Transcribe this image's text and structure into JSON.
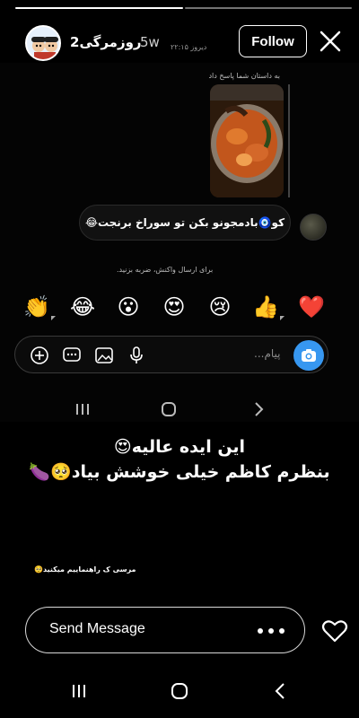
{
  "story": {
    "progress_segments": 2,
    "progress_filled": 1
  },
  "header": {
    "username": "روزمرگی2",
    "age": "5w",
    "follow_label": "Follow"
  },
  "dm": {
    "reply_caption": "به داستان شما پاسخ داد",
    "time_label": "دیروز ۲۲:۱۵",
    "message": "کو🧿بادمجونو بکن تو سوراخ برنجت😂",
    "reaction_hint": "برای ارسال واکنش، ضربه بزنید.",
    "reactions": [
      "❤️",
      "👍",
      "😢",
      "😍",
      "😮",
      "😂",
      "👏"
    ],
    "composer_placeholder": "پیام..."
  },
  "caption": {
    "line1": "این ایده عالیه😍",
    "line2": "بنظرم کاظم خیلی خوشش بیاد🥺🍆",
    "note": "مرسی ک راهنماییم میکنید🥺"
  },
  "send_bar": {
    "placeholder": "Send Message"
  },
  "icons": {
    "close": "close-icon",
    "like": "heart-icon",
    "camera": "camera-icon"
  },
  "colors": {
    "camera_blue": "#3797f0",
    "background": "#000000"
  }
}
